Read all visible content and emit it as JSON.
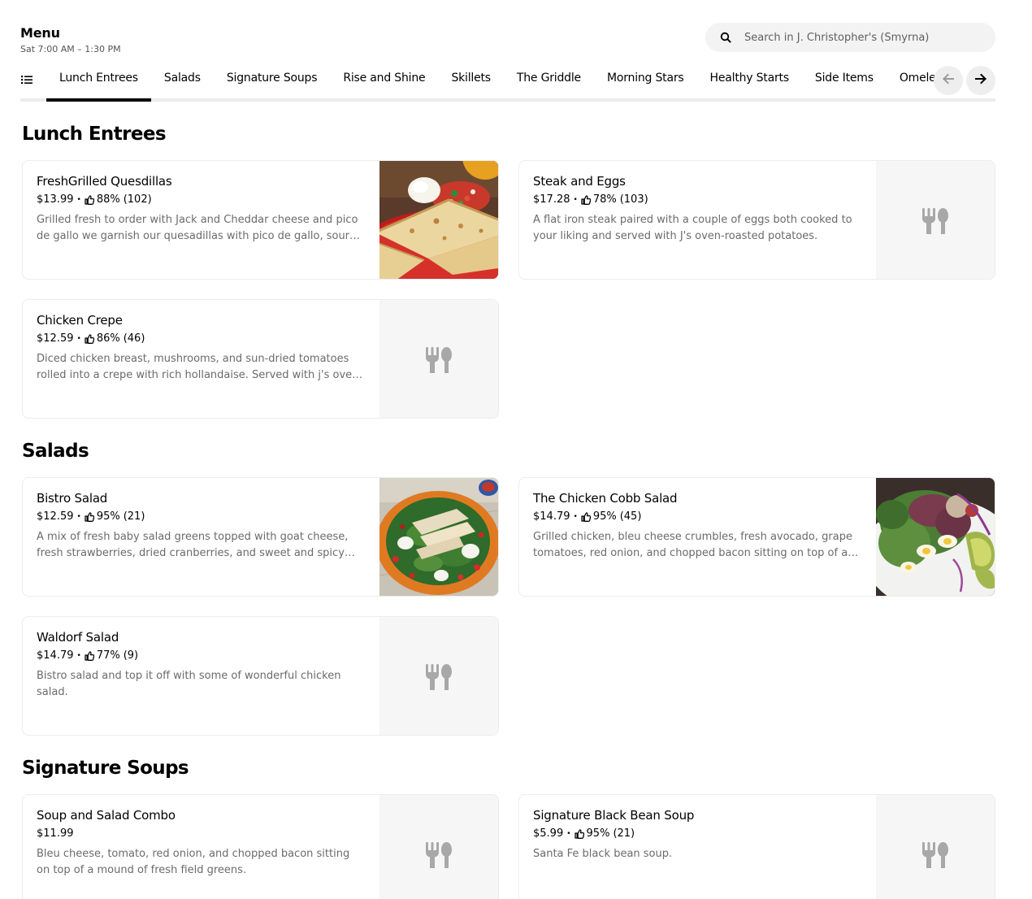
{
  "header": {
    "title": "Menu",
    "hours": "Sat 7:00 AM – 1:30 PM"
  },
  "search": {
    "placeholder": "Search in J. Christopher's (Smyrna)"
  },
  "tabs": [
    {
      "label": "Lunch Entrees",
      "active": true
    },
    {
      "label": "Salads",
      "active": false
    },
    {
      "label": "Signature Soups",
      "active": false
    },
    {
      "label": "Rise and Shine",
      "active": false
    },
    {
      "label": "Skillets",
      "active": false
    },
    {
      "label": "The Griddle",
      "active": false
    },
    {
      "label": "Morning Stars",
      "active": false
    },
    {
      "label": "Healthy Starts",
      "active": false
    },
    {
      "label": "Side Items",
      "active": false
    },
    {
      "label": "Omelet",
      "active": false
    }
  ],
  "sections": [
    {
      "title": "Lunch Entrees",
      "items": [
        {
          "name": "FreshGrilled Quesdillas",
          "price": "$13.99",
          "rating": "88%",
          "count": "(102)",
          "desc": "Grilled fresh to order with Jack and Cheddar cheese and pico de gallo we garnish our quesadillas with pico de gallo, sour cream and guacamole.",
          "image": "quesadilla-photo"
        },
        {
          "name": "Steak and Eggs",
          "price": "$17.28",
          "rating": "78%",
          "count": "(103)",
          "desc": "A flat iron steak paired with a couple of eggs both cooked to your liking and served with J's oven-roasted potatoes.",
          "image": "placeholder"
        },
        {
          "name": "Chicken Crepe",
          "price": "$12.59",
          "rating": "86%",
          "count": "(46)",
          "desc": "Diced chicken breast, mushrooms, and sun-dried tomatoes rolled into a crepe with rich hollandaise. Served with j's oven-roasted potatoes.",
          "image": "placeholder"
        }
      ]
    },
    {
      "title": "Salads",
      "items": [
        {
          "name": "Bistro Salad",
          "price": "$12.59",
          "rating": "95%",
          "count": "(21)",
          "desc": "A mix of fresh baby salad greens topped with goat cheese, fresh strawberries, dried cranberries, and sweet and spicy pecans.",
          "image": "bistro-salad-photo"
        },
        {
          "name": "The Chicken Cobb Salad",
          "price": "$14.79",
          "rating": "95%",
          "count": "(45)",
          "desc": "Grilled chicken, bleu cheese crumbles, fresh avocado, grape tomatoes, red onion, and chopped bacon sitting on top of a mound of fresh field greens.",
          "image": "cobb-salad-photo"
        },
        {
          "name": "Waldorf Salad",
          "price": "$14.79",
          "rating": "77%",
          "count": "(9)",
          "desc": "Bistro salad and top it off with some of wonderful chicken salad.",
          "image": "placeholder"
        }
      ]
    },
    {
      "title": "Signature Soups",
      "items": [
        {
          "name": "Soup and Salad Combo",
          "price": "$11.99",
          "rating": "",
          "count": "",
          "desc": "Bleu cheese, tomato, red onion, and chopped bacon sitting on top of a mound of fresh field greens.",
          "image": "placeholder"
        },
        {
          "name": "Signature Black Bean Soup",
          "price": "$5.99",
          "rating": "95%",
          "count": "(21)",
          "desc": "Santa Fe black bean soup.",
          "image": "placeholder"
        }
      ]
    }
  ],
  "colors": {
    "accent": "#000000",
    "muted_text": "#6b6b6b",
    "placeholder_bg": "#f6f6f6",
    "utensils_icon": "#a8a8a8"
  },
  "icons": [
    "search-icon",
    "list-icon",
    "arrow-left-icon",
    "arrow-right-icon",
    "thumbs-up-icon",
    "utensils-icon"
  ]
}
